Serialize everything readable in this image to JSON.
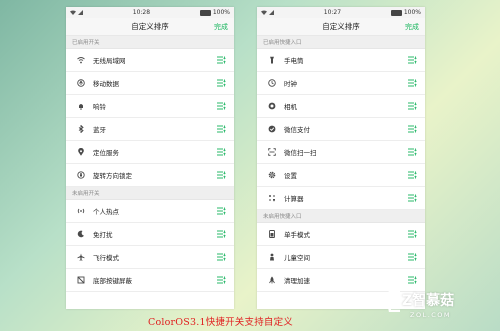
{
  "left": {
    "time": "10:28",
    "battery": "100%",
    "title": "自定义排序",
    "done": "完成",
    "enabled_header": "已启用开关",
    "enabled": [
      {
        "label": "无线局域网",
        "icon": "wifi-icon"
      },
      {
        "label": "移动数据",
        "icon": "mobile-data-icon"
      },
      {
        "label": "响铃",
        "icon": "bell-icon"
      },
      {
        "label": "蓝牙",
        "icon": "bluetooth-icon"
      },
      {
        "label": "定位服务",
        "icon": "location-icon"
      },
      {
        "label": "旋转方向锁定",
        "icon": "rotation-lock-icon"
      }
    ],
    "disabled_header": "未启用开关",
    "disabled": [
      {
        "label": "个人热点",
        "icon": "hotspot-icon"
      },
      {
        "label": "免打扰",
        "icon": "moon-icon"
      },
      {
        "label": "飞行模式",
        "icon": "airplane-icon"
      },
      {
        "label": "底部按键屏蔽",
        "icon": "button-block-icon"
      }
    ]
  },
  "right": {
    "time": "10:27",
    "battery": "100%",
    "title": "自定义排序",
    "done": "完成",
    "enabled_header": "已启用快捷入口",
    "enabled": [
      {
        "label": "手电筒",
        "icon": "flashlight-icon"
      },
      {
        "label": "时钟",
        "icon": "clock-icon"
      },
      {
        "label": "相机",
        "icon": "camera-icon"
      },
      {
        "label": "微信支付",
        "icon": "wechat-pay-icon"
      },
      {
        "label": "微信扫一扫",
        "icon": "wechat-scan-icon"
      },
      {
        "label": "设置",
        "icon": "gear-icon"
      },
      {
        "label": "计算器",
        "icon": "calculator-icon"
      }
    ],
    "disabled_header": "未启用快捷入口",
    "disabled": [
      {
        "label": "单手模式",
        "icon": "one-hand-icon"
      },
      {
        "label": "儿童空间",
        "icon": "kids-icon"
      },
      {
        "label": "清理加速",
        "icon": "rocket-icon"
      }
    ]
  },
  "caption": "ColorOS3.1快捷开关支持自定义",
  "watermark": {
    "text": "Z智慕菇",
    "sub": "ZOL.COM"
  },
  "colors": {
    "accent": "#19b55e",
    "caption": "#e02020",
    "icon": "#4a4a4a"
  }
}
